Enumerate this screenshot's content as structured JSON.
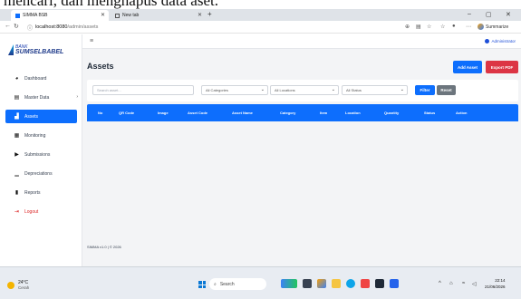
{
  "caption": "mencari, dan menghapus data aset.",
  "browser": {
    "tabs": [
      {
        "label": "SIMMA BSB",
        "active": true
      },
      {
        "label": "New tab",
        "active": false
      }
    ],
    "url_host": "localhost:8080",
    "url_path": "/admin/assets",
    "summarize_label": "Summarize"
  },
  "app": {
    "logo_line1": "BANK",
    "logo_line2": "SUMSELBABEL",
    "admin_label": "Administrator",
    "menu": [
      {
        "label": "Dashboard",
        "icon": "dashboard-icon",
        "glyph": "◕"
      },
      {
        "label": "Master Data",
        "icon": "database-icon",
        "glyph": "▤",
        "has_submenu": true
      },
      {
        "label": "Assets",
        "icon": "boxes-icon",
        "glyph": "▟",
        "active": true
      },
      {
        "label": "Monitoring",
        "icon": "clipboard-icon",
        "glyph": "▦"
      },
      {
        "label": "Submissions",
        "icon": "truck-icon",
        "glyph": "▶"
      },
      {
        "label": "Depreciations",
        "icon": "chart-icon",
        "glyph": "▁"
      },
      {
        "label": "Reports",
        "icon": "file-icon",
        "glyph": "▮"
      },
      {
        "label": "Logout",
        "icon": "logout-icon",
        "glyph": "⇥"
      }
    ],
    "page_title": "Assets",
    "add_button": "Add Asset",
    "export_button": "Export PDF",
    "filters": {
      "search_placeholder": "Search asset...",
      "category": "All Categories",
      "location": "All Locations",
      "status": "All Status",
      "filter_button": "Filter",
      "reset_button": "Reset"
    },
    "table_headers": [
      "No",
      "QR Code",
      "Image",
      "Asset Code",
      "Asset Name",
      "Category",
      "Item",
      "Location",
      "Quantity",
      "Status",
      "Action"
    ],
    "footer": "SIMMA v1.0 | © 2026"
  },
  "taskbar": {
    "temperature": "24°C",
    "condition": "Cerah",
    "search_label": "Search",
    "time": "22:14",
    "date": "21/06/2026"
  }
}
